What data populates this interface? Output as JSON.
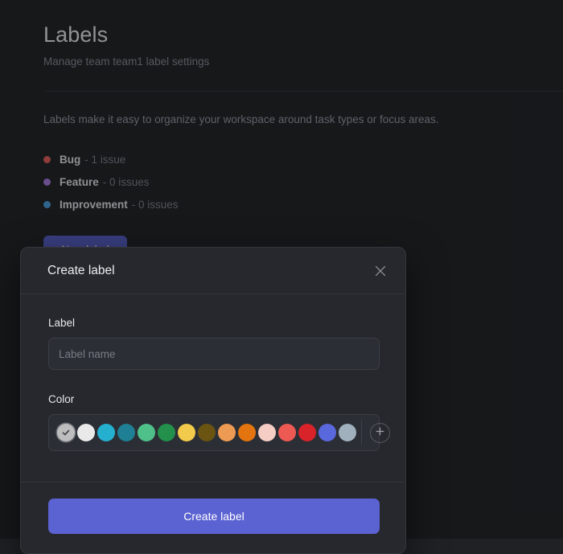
{
  "page": {
    "title": "Labels",
    "subtitle": "Manage team team1 label settings",
    "description": "Labels make it easy to organize your workspace around task types or focus areas.",
    "new_label_button": "New label",
    "labels": [
      {
        "name": "Bug",
        "count": "- 1 issue",
        "color": "#ef5f5d"
      },
      {
        "name": "Feature",
        "count": "- 0 issues",
        "color": "#b07ce8"
      },
      {
        "name": "Improvement",
        "count": "- 0 issues",
        "color": "#4aa6e8"
      }
    ]
  },
  "modal": {
    "title": "Create label",
    "close_icon": "close-icon",
    "label_field": {
      "label": "Label",
      "value": "",
      "placeholder": "Label name"
    },
    "color_field": {
      "label": "Color",
      "add_icon": "plus-circle-icon",
      "selected_index": 0,
      "swatches": [
        "#bdbdbd",
        "#e9e9e9",
        "#25b0d0",
        "#1f7f94",
        "#4fc08a",
        "#23904c",
        "#f2ca4c",
        "#6b5412",
        "#ed9a53",
        "#e3740f",
        "#f5cdc4",
        "#ed5a54",
        "#d8232a",
        "#5a68de",
        "#a0b0bd"
      ]
    },
    "submit_button": "Create label"
  }
}
